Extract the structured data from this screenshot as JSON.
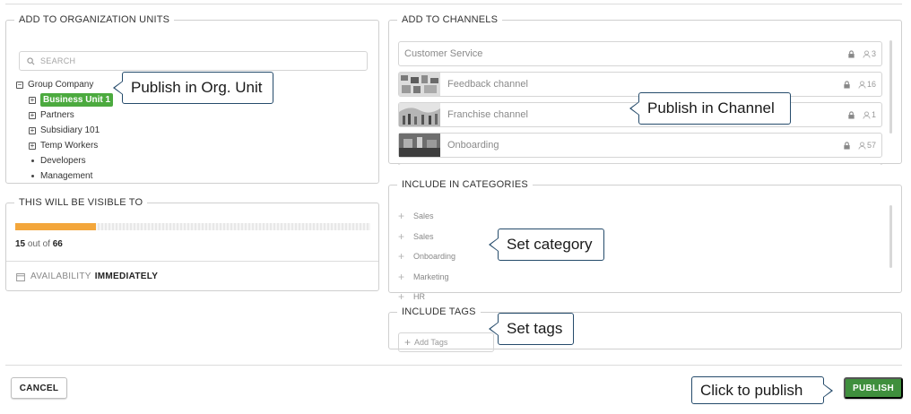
{
  "org_units": {
    "legend": "ADD TO ORGANIZATION UNITS",
    "search_placeholder": "SEARCH",
    "tree": [
      {
        "label": "Group Company",
        "kind": "collapse",
        "depth": 0
      },
      {
        "label": "Business Unit 1",
        "kind": "expand",
        "depth": 1,
        "selected": true
      },
      {
        "label": "Partners",
        "kind": "expand",
        "depth": 1
      },
      {
        "label": "Subsidiary 101",
        "kind": "expand",
        "depth": 1
      },
      {
        "label": "Temp Workers",
        "kind": "expand",
        "depth": 1
      },
      {
        "label": "Developers",
        "kind": "leaf",
        "depth": 1
      },
      {
        "label": "Management",
        "kind": "leaf",
        "depth": 1
      }
    ]
  },
  "visibility": {
    "legend": "THIS WILL BE VISIBLE TO",
    "count": "15",
    "out_of": "out of",
    "total": "66",
    "fraction": 0.227,
    "availability_label": "AVAILABILITY",
    "availability_value": "IMMEDIATELY"
  },
  "channels": {
    "legend": "ADD TO CHANNELS",
    "items": [
      {
        "name": "Customer Service",
        "members": "3",
        "thumb": false
      },
      {
        "name": "Feedback channel",
        "members": "16",
        "thumb": true
      },
      {
        "name": "Franchise channel",
        "members": "1",
        "thumb": true
      },
      {
        "name": "Onboarding",
        "members": "57",
        "thumb": true
      }
    ]
  },
  "categories": {
    "legend": "INCLUDE IN CATEGORIES",
    "items": [
      "Sales",
      "Sales",
      "Onboarding",
      "Marketing",
      "HR"
    ]
  },
  "tags": {
    "legend": "INCLUDE TAGS",
    "placeholder": "Add Tags"
  },
  "buttons": {
    "cancel": "CANCEL",
    "publish": "PUBLISH"
  },
  "callouts": {
    "org_unit": "Publish in Org. Unit",
    "channel": "Publish in Channel",
    "category": "Set category",
    "tags": "Set tags",
    "publish": "Click to publish"
  },
  "colors": {
    "selected_green": "#4caa3f",
    "publish_green": "#3f8f3d",
    "progress_orange": "#f3a63b",
    "callout_border": "#254b6b"
  }
}
